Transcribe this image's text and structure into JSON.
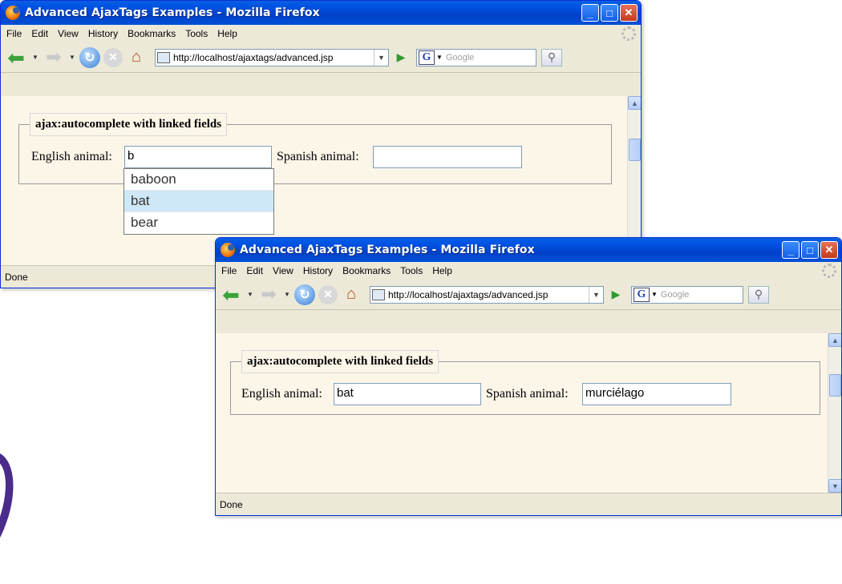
{
  "windows": [
    {
      "title": "Advanced AjaxTags Examples - Mozilla Firefox",
      "menu": [
        "File",
        "Edit",
        "View",
        "History",
        "Bookmarks",
        "Tools",
        "Help"
      ],
      "url": "http://localhost/ajaxtags/advanced.jsp",
      "search_placeholder": "Google",
      "legend": "ajax:autocomplete with linked fields",
      "english_label": "English animal:",
      "english_value": "b",
      "spanish_label": "Spanish animal:",
      "spanish_value": "",
      "suggestions": [
        "baboon",
        "bat",
        "bear"
      ],
      "selected_suggestion": "bat",
      "status": "Done"
    },
    {
      "title": "Advanced AjaxTags Examples - Mozilla Firefox",
      "menu": [
        "File",
        "Edit",
        "View",
        "History",
        "Bookmarks",
        "Tools",
        "Help"
      ],
      "url": "http://localhost/ajaxtags/advanced.jsp",
      "search_placeholder": "Google",
      "legend": "ajax:autocomplete with linked fields",
      "english_label": "English animal:",
      "english_value": "bat",
      "spanish_label": "Spanish animal:",
      "spanish_value": "murciélago",
      "status": "Done"
    }
  ],
  "colors": {
    "titlebar": "#0055e5",
    "page_background": "#fcf6e8",
    "chrome": "#ece9d8",
    "selected_suggestion": "#cfe8f7"
  }
}
